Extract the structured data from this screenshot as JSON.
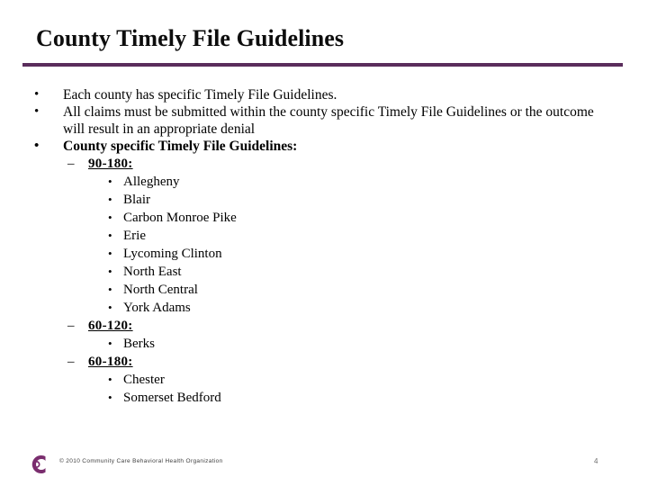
{
  "slide": {
    "title": "County Timely File Guidelines",
    "accent_color": "#5a2d5c",
    "bullets": [
      {
        "marker": "•",
        "text": "Each county has specific Timely File Guidelines.",
        "bold": false
      },
      {
        "marker": "•",
        "text": "All claims must be submitted within the county specific Timely File Guidelines or the outcome will result in an appropriate denial",
        "bold": false
      },
      {
        "marker": "•",
        "text": "County specific Timely File Guidelines:",
        "bold": true
      }
    ],
    "groups": [
      {
        "marker": "–",
        "heading": "90-180:",
        "item_marker": "•",
        "counties": [
          "Allegheny",
          "Blair",
          "Carbon Monroe Pike",
          "Erie",
          "Lycoming Clinton",
          "North East",
          "North Central",
          "York Adams"
        ]
      },
      {
        "marker": "–",
        "heading": "60-120:",
        "item_marker": "•",
        "counties": [
          "Berks"
        ]
      },
      {
        "marker": "–",
        "heading": "60-180:",
        "item_marker": "•",
        "counties": [
          "Chester",
          "Somerset Bedford"
        ]
      }
    ]
  },
  "footer": {
    "logo_letter": "C",
    "logo_color": "#7a2d6e",
    "copyright": "© 2010 Community Care Behavioral Health Organization",
    "page_number": "4"
  }
}
